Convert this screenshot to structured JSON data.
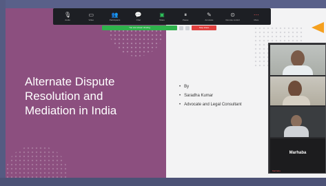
{
  "toolbar": {
    "buttons": [
      {
        "label": "Audio",
        "icon": "microphone-icon",
        "glyph": "🎙"
      },
      {
        "label": "Video",
        "icon": "video-camera-icon",
        "glyph": "▭"
      },
      {
        "label": "Participants",
        "icon": "participants-icon",
        "glyph": "👥"
      },
      {
        "label": "Chat",
        "icon": "chat-icon",
        "glyph": "💬"
      },
      {
        "label": "Share",
        "icon": "share-screen-icon",
        "glyph": "▣"
      },
      {
        "label": "Pause",
        "icon": "pause-icon",
        "glyph": "⏸"
      },
      {
        "label": "Annotate",
        "icon": "annotate-icon",
        "glyph": "✎"
      },
      {
        "label": "Remote control",
        "icon": "remote-control-icon",
        "glyph": "⊙"
      },
      {
        "label": "More",
        "icon": "more-icon",
        "glyph": "⋯"
      }
    ]
  },
  "share_bar": {
    "status": "You are screen sharing",
    "stop_label": "Stop share"
  },
  "slide": {
    "title": "Alternate Dispute\nResolution and\nMediation in India",
    "bullets": [
      "By",
      "Saradha Kumar",
      "Advocate and Legal Consultant"
    ]
  },
  "gallery": {
    "featured_name": "Marhaba",
    "self_label": "Marhaba"
  },
  "colors": {
    "slide_accent": "#8c4f7f",
    "share_green": "#2fb24c",
    "stop_red": "#e0403e",
    "pointer_arrow": "#f5a01f"
  }
}
